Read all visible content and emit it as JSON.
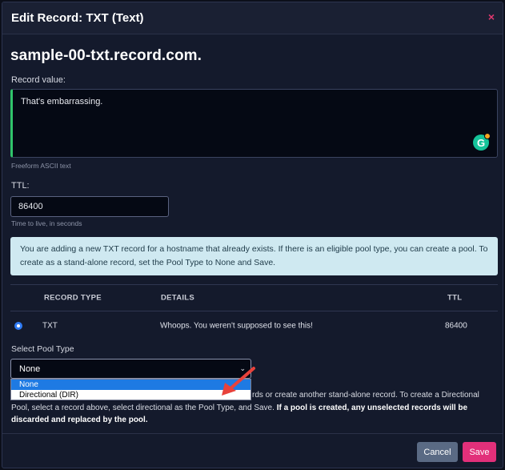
{
  "modal": {
    "title": "Edit Record: TXT (Text)",
    "close_glyph": "×",
    "hostname": "sample-00-txt.record.com."
  },
  "record_value": {
    "label": "Record value:",
    "value": "That's embarrassing.",
    "hint": "Freeform ASCII text",
    "extension_icon": "grammarly-icon"
  },
  "ttl": {
    "label": "TTL:",
    "value": "86400",
    "hint": "Time to live, in seconds"
  },
  "alert": {
    "text": "You are adding a new TXT record for a hostname that already exists. If there is an eligible pool type, you can create a pool. To create as a stand-alone record, set the Pool Type to None and Save."
  },
  "table": {
    "headers": [
      "RECORD TYPE",
      "DETAILS",
      "TTL"
    ],
    "rows": [
      {
        "type": "TXT",
        "details": "Whoops. You weren't supposed to see this!",
        "ttl": "86400",
        "selected": true
      }
    ]
  },
  "pool": {
    "label": "Select Pool Type",
    "selected": "None",
    "options": [
      "None",
      "Directional (DIR)"
    ]
  },
  "info": {
    "text_visible": "rds or create another stand-alone record. To create a Directional Pool, select a record above, select directional as the Pool Type, and Save.",
    "bold_text": "If a pool is created, any unselected records will be discarded and replaced by the pool."
  },
  "footer": {
    "cancel_label": "Cancel",
    "save_label": "Save"
  },
  "colors": {
    "accent_pink": "#e2307a",
    "input_left_border": "#30c46a",
    "alert_bg": "#cfe9f1",
    "dropdown_selected": "#1e7ae3",
    "annotation_arrow": "#e8423b"
  }
}
